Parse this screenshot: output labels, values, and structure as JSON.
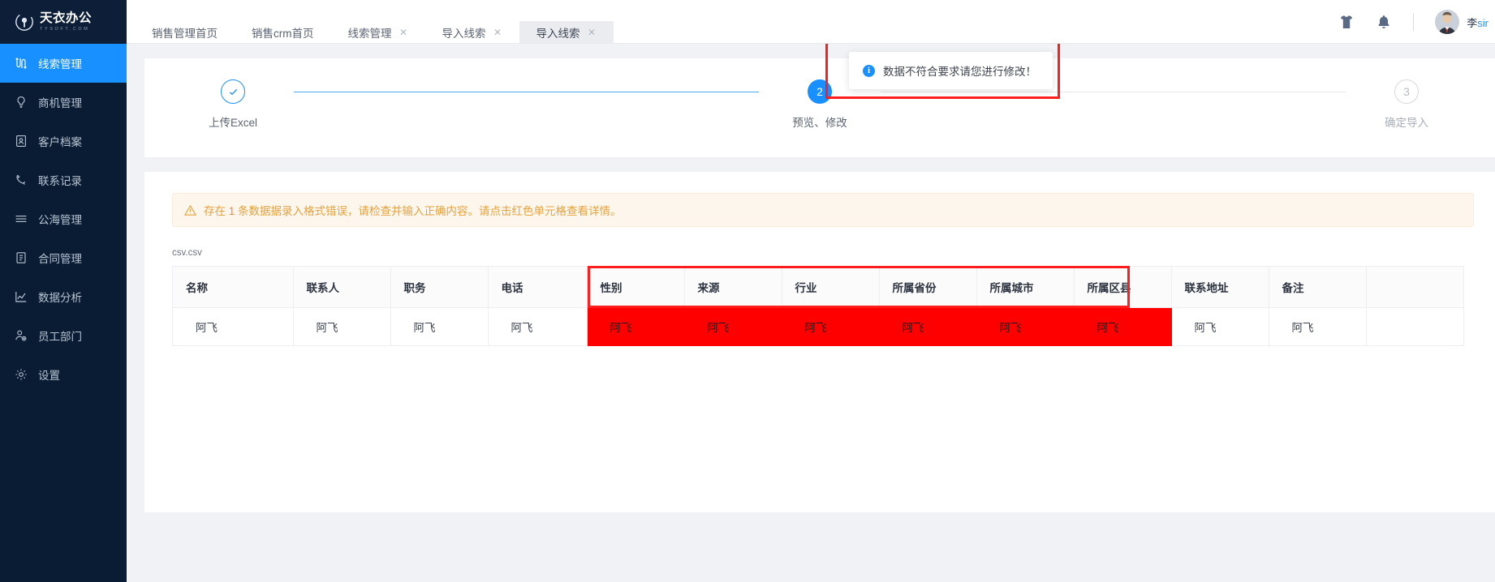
{
  "brand": {
    "name": "天衣办公",
    "sub": "TYSOFT.COM",
    "logo_icon": "logo-icon"
  },
  "sidebar": {
    "items": [
      {
        "label": "线索管理",
        "icon": "thread-icon",
        "active": true
      },
      {
        "label": "商机管理",
        "icon": "bulb-icon",
        "active": false
      },
      {
        "label": "客户档案",
        "icon": "file-user-icon",
        "active": false
      },
      {
        "label": "联系记录",
        "icon": "phone-icon",
        "active": false
      },
      {
        "label": "公海管理",
        "icon": "waves-icon",
        "active": false
      },
      {
        "label": "合同管理",
        "icon": "contract-icon",
        "active": false
      },
      {
        "label": "数据分析",
        "icon": "chart-line-icon",
        "active": false
      },
      {
        "label": "员工部门",
        "icon": "user-gear-icon",
        "active": false
      },
      {
        "label": "设置",
        "icon": "gear-icon",
        "active": false
      }
    ]
  },
  "header": {
    "shirt_icon": "tshirt-icon",
    "bell_icon": "bell-icon",
    "avatar_icon": "avatar-icon",
    "user_name_prefix": "李",
    "user_name_suffix": "sir"
  },
  "tabs": [
    {
      "label": "销售管理首页",
      "closable": false,
      "active": false
    },
    {
      "label": "销售crm首页",
      "closable": false,
      "active": false
    },
    {
      "label": "线索管理",
      "closable": true,
      "active": false
    },
    {
      "label": "导入线索",
      "closable": true,
      "active": false
    },
    {
      "label": "导入线索",
      "closable": true,
      "active": true
    }
  ],
  "tab_close_glyph": "✕",
  "toast": {
    "text": "数据不符合要求请您进行修改！",
    "icon": "info-circle-icon",
    "icon_glyph": "i",
    "annotation_color": "#ff1e1e"
  },
  "stepper": {
    "steps": [
      {
        "label": "上传Excel",
        "state": "done",
        "marker": "✓"
      },
      {
        "label": "预览、修改",
        "state": "current",
        "marker": "2"
      },
      {
        "label": "确定导入",
        "state": "todo",
        "marker": "3"
      }
    ]
  },
  "alert": {
    "icon": "warning-triangle-icon",
    "prefix": "存在 ",
    "count": "1",
    "suffix": " 条数据据录入格式错误，请检查并输入正确内容。请点击红色单元格查看详情。"
  },
  "table": {
    "filename": "csv.csv",
    "columns": [
      {
        "label": "名称",
        "error": false,
        "width": "148"
      },
      {
        "label": "联系人",
        "error": false,
        "width": "120"
      },
      {
        "label": "职务",
        "error": false,
        "width": "120"
      },
      {
        "label": "电话",
        "error": false,
        "width": "122"
      },
      {
        "label": "性别",
        "error": true,
        "width": "120"
      },
      {
        "label": "来源",
        "error": true,
        "width": "120"
      },
      {
        "label": "行业",
        "error": true,
        "width": "120"
      },
      {
        "label": "所属省份",
        "error": true,
        "width": "120"
      },
      {
        "label": "所属城市",
        "error": true,
        "width": "120"
      },
      {
        "label": "所属区县",
        "error": true,
        "width": "120"
      },
      {
        "label": "联系地址",
        "error": false,
        "width": "120"
      },
      {
        "label": "备注",
        "error": false,
        "width": "120"
      },
      {
        "label": "",
        "error": false,
        "width": "150"
      }
    ],
    "rows": [
      {
        "cells": [
          {
            "value": "阿飞",
            "error": false
          },
          {
            "value": "阿飞",
            "error": false
          },
          {
            "value": "阿飞",
            "error": false
          },
          {
            "value": "阿飞",
            "error": false
          },
          {
            "value": "阿飞",
            "error": true
          },
          {
            "value": "阿飞",
            "error": true
          },
          {
            "value": "阿飞",
            "error": true
          },
          {
            "value": "阿飞",
            "error": true
          },
          {
            "value": "阿飞",
            "error": true
          },
          {
            "value": "阿飞",
            "error": true
          },
          {
            "value": "阿飞",
            "error": false
          },
          {
            "value": "阿飞",
            "error": false
          },
          {
            "value": "",
            "error": false
          }
        ]
      }
    ]
  },
  "colors": {
    "accent": "#1890ff",
    "sidebar_bg": "#0a1c33",
    "error_cell": "#fe0000",
    "annotation": "#ff1e1e",
    "warning": "#e6a23c"
  }
}
